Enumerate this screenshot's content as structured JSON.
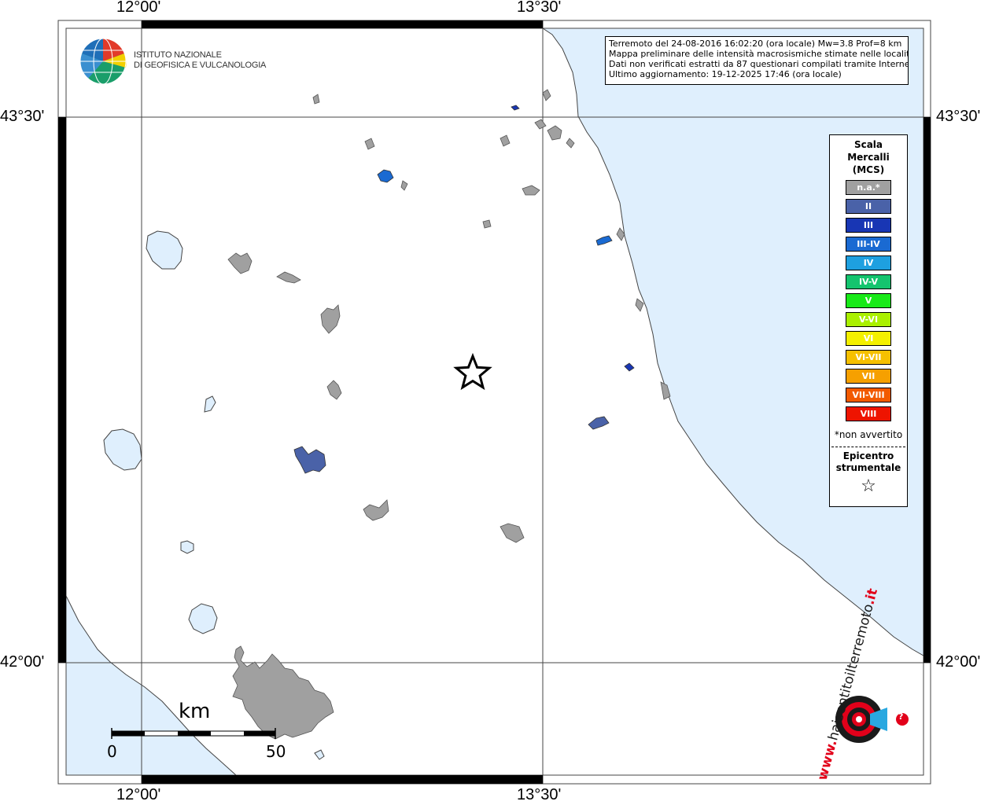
{
  "coords": {
    "top_left_lon": "12°00'",
    "top_right_lon": "13°30'",
    "bottom_left_lon": "12°00'",
    "bottom_right_lon": "13°30'",
    "left_top_lat": "43°30'",
    "left_bottom_lat": "42°00'",
    "right_top_lat": "43°30'",
    "right_bottom_lat": "42°00'"
  },
  "logo": {
    "line1": "ISTITUTO NAZIONALE",
    "line2": "DI GEOFISICA E VULCANOLOGIA"
  },
  "info": {
    "line1": "Terremoto del 24-08-2016 16:02:20 (ora locale) Mw=3.8 Prof=8 km",
    "line2": "Mappa preliminare delle intensità macrosismiche stimate nelle località",
    "line3": "Dati non verificati estratti da 87 questionari compilati tramite Internet.",
    "line4": "Ultimo aggiornamento: 19-12-2025 17:46 (ora locale)"
  },
  "legend": {
    "title1": "Scala",
    "title2": "Mercalli",
    "title3": "(MCS)",
    "items": [
      {
        "label": "n.a.*",
        "color": "#a0a0a0"
      },
      {
        "label": "II",
        "color": "#4a62a8"
      },
      {
        "label": "III",
        "color": "#1836b4"
      },
      {
        "label": "III-IV",
        "color": "#1a6ad2"
      },
      {
        "label": "IV",
        "color": "#1ea0e0"
      },
      {
        "label": "IV-V",
        "color": "#14c46e"
      },
      {
        "label": "V",
        "color": "#18ea18"
      },
      {
        "label": "V-VI",
        "color": "#aaf000"
      },
      {
        "label": "VI",
        "color": "#f4f000"
      },
      {
        "label": "VI-VII",
        "color": "#f6c000"
      },
      {
        "label": "VII",
        "color": "#f6a000"
      },
      {
        "label": "VII-VIII",
        "color": "#f25a00"
      },
      {
        "label": "VIII",
        "color": "#ee1400"
      }
    ],
    "note": "*non avvertito",
    "epi1": "Epicentro",
    "epi2": "strumentale",
    "star": "☆"
  },
  "scale": {
    "unit": "km",
    "min": "0",
    "max": "50"
  },
  "hsit": {
    "main": "haisentitoilterremoto",
    "tld": ".it",
    "www": "www.",
    "q": "?"
  },
  "colors": {
    "sea": "#dfeffd",
    "city_gray": "#a0a0a0",
    "intensity_II": "#4a62a8",
    "intensity_III": "#1836b4",
    "intensity_III_IV": "#1a6ad2"
  }
}
